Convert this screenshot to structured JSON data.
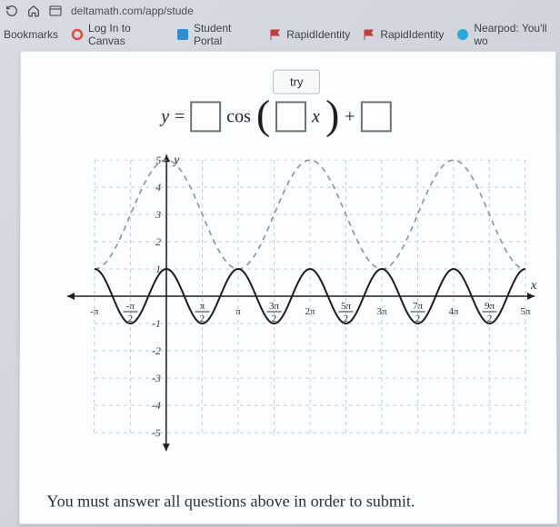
{
  "toolbar": {
    "url_fragment": "deltamath.com/app/stude"
  },
  "bookmarks": {
    "label": "Bookmarks",
    "items": [
      {
        "label": "Log In to Canvas",
        "color": "#e24a3b",
        "shape": "ring"
      },
      {
        "label": "Student Portal",
        "color": "#2b8fd6",
        "shape": "square"
      },
      {
        "label": "RapidIdentity",
        "color": "#c43a3a",
        "shape": "flag"
      },
      {
        "label": "RapidIdentity",
        "color": "#c43a3a",
        "shape": "flag"
      },
      {
        "label": "Nearpod: You'll wo",
        "color": "#2aa8d8",
        "shape": "circle"
      }
    ]
  },
  "try_label": "try",
  "equation": {
    "y": "y",
    "equals": "=",
    "func": "cos",
    "x": "x",
    "plus": "+"
  },
  "footer": "You must answer all questions above in order to submit.",
  "chart_data": {
    "type": "line",
    "xlabel": "x",
    "ylabel": "y",
    "xlim_pi": [
      -1,
      5
    ],
    "ylim": [
      -5,
      5
    ],
    "y_ticks": [
      -5,
      -4,
      -3,
      -2,
      -1,
      1,
      2,
      3,
      4,
      5
    ],
    "x_ticks_pi_halves": [
      -2,
      -1,
      1,
      2,
      3,
      4,
      5,
      6,
      7,
      8,
      9,
      10
    ],
    "x_tick_labels": [
      "-π",
      "-π/2",
      "π/2",
      "π",
      "3π/2",
      "2π",
      "5π/2",
      "3π",
      "7π/2",
      "4π",
      "9π/2",
      "5π"
    ],
    "series": [
      {
        "name": "reference-dashed",
        "style": "dashed",
        "color": "#8a8f99",
        "formula": "y = 2 cos(x) + 3",
        "amplitude": 2,
        "angular_frequency": 1,
        "vertical_shift": 3
      },
      {
        "name": "answer-solid",
        "style": "solid",
        "color": "#1c1e22",
        "formula": "y = cos(2x)",
        "amplitude": 1,
        "angular_frequency": 2,
        "vertical_shift": 0
      }
    ]
  }
}
